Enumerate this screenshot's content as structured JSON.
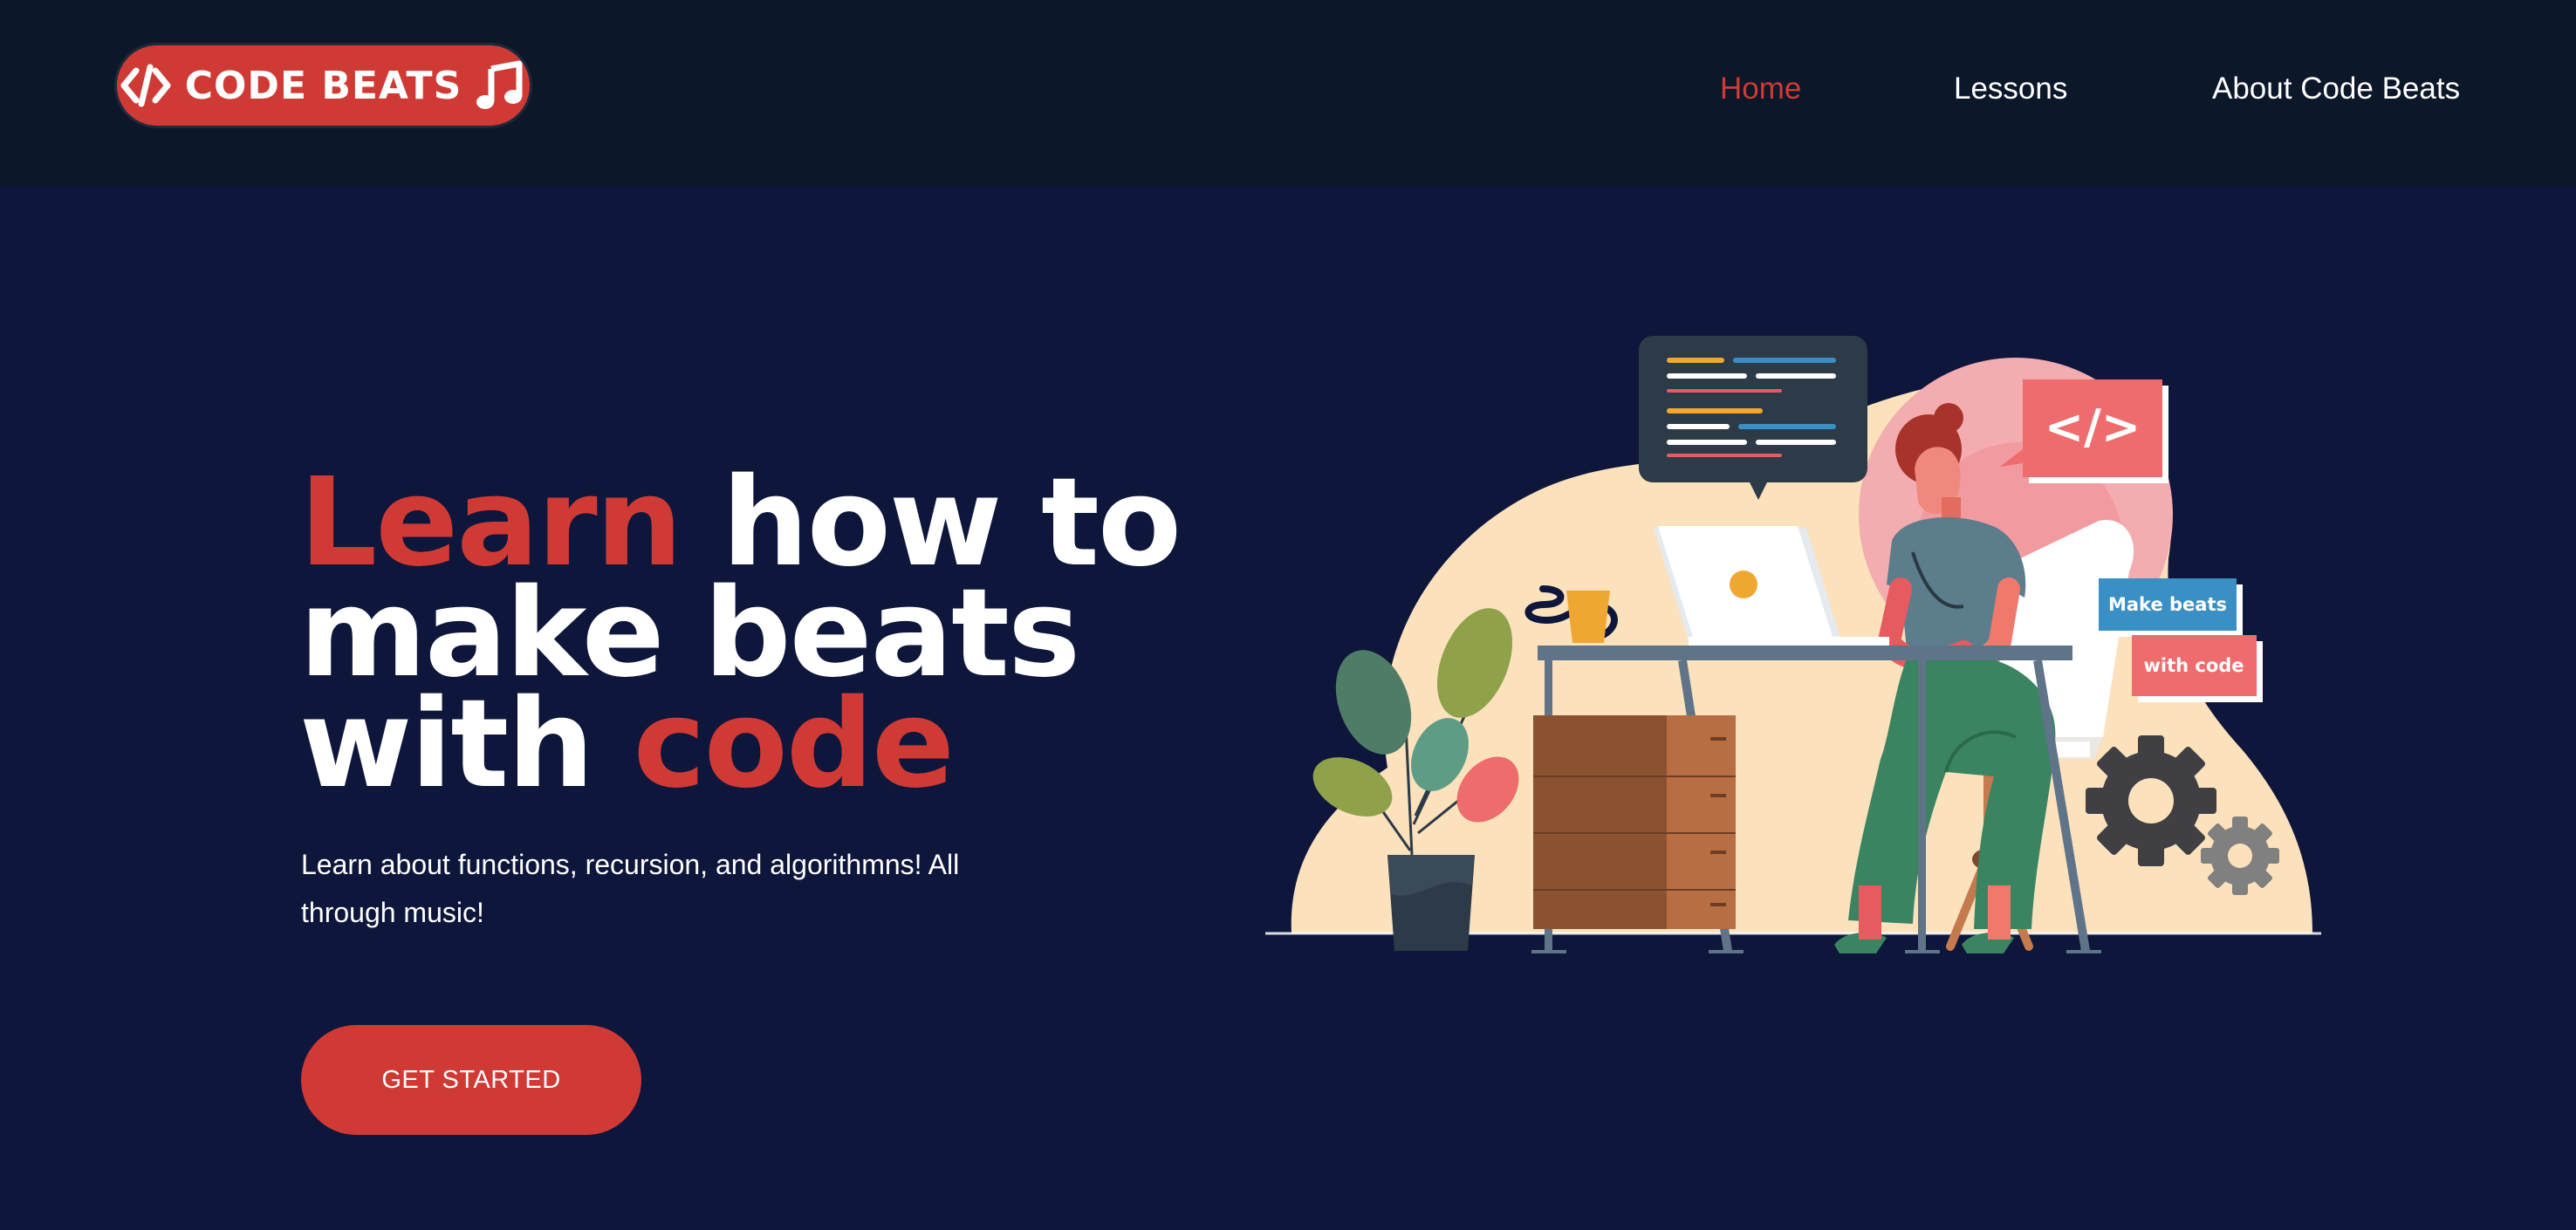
{
  "brand": {
    "logo_text": "CODE BEATS",
    "logo_icon": "code-brackets-icon",
    "logo_note_icon": "music-note-icon",
    "color": "#d03a35"
  },
  "nav": {
    "items": [
      {
        "label": "Home",
        "active": true
      },
      {
        "label": "Lessons",
        "active": false
      },
      {
        "label": "About Code Beats",
        "active": false
      }
    ]
  },
  "hero": {
    "title_parts": [
      "Learn",
      "how to",
      "make beats",
      "with",
      "code"
    ],
    "subtitle": "Learn about functions, recursion, and algorithmns! All through music!",
    "cta_label": "GET STARTED"
  },
  "illustration": {
    "code_tag": "</>",
    "tag_line_1": "Make beats",
    "tag_line_2": "with code"
  },
  "colors": {
    "page_bg": "#0e163b",
    "nav_bg": "#0c172a",
    "accent": "#d03a35",
    "text": "#ffffff"
  }
}
